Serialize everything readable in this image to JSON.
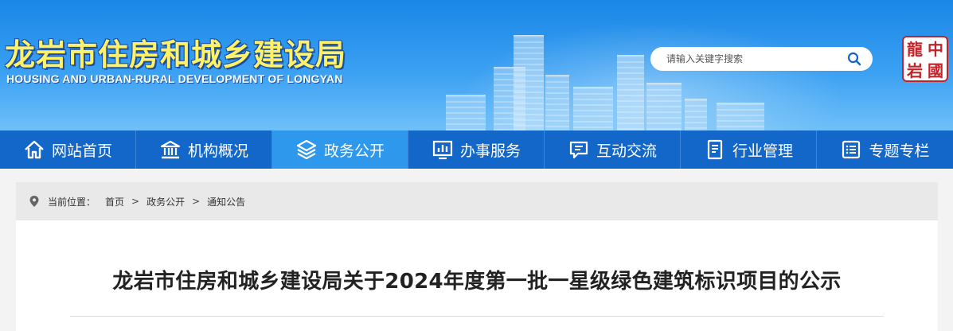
{
  "header": {
    "title_cn": "龙岩市住房和城乡建设局",
    "title_en": "HOUSING AND URBAN-RURAL DEVELOPMENT OF LONGYAN",
    "seal_chars": [
      "龍",
      "中",
      "岩",
      "國"
    ]
  },
  "search": {
    "placeholder": "请输入关键字搜索",
    "icon": "search-icon"
  },
  "nav": {
    "items": [
      {
        "label": "网站首页",
        "icon": "home-icon"
      },
      {
        "label": "机构概况",
        "icon": "institution-icon"
      },
      {
        "label": "政务公开",
        "icon": "layers-icon"
      },
      {
        "label": "办事服务",
        "icon": "chart-icon"
      },
      {
        "label": "互动交流",
        "icon": "chat-icon"
      },
      {
        "label": "行业管理",
        "icon": "document-icon"
      },
      {
        "label": "专题专栏",
        "icon": "list-icon"
      }
    ],
    "active_index": 2
  },
  "breadcrumb": {
    "prefix": "当前位置：",
    "items": [
      "首页",
      "政务公开",
      "通知公告"
    ],
    "separator": ">"
  },
  "article": {
    "title": "龙岩市住房和城乡建设局关于2024年度第一批一星级绿色建筑标识项目的公示"
  },
  "colors": {
    "nav_bg": "#1367c8",
    "nav_active": "#2d98ec",
    "header_top": "#1a86e6",
    "logo_text": "#fff06a"
  }
}
